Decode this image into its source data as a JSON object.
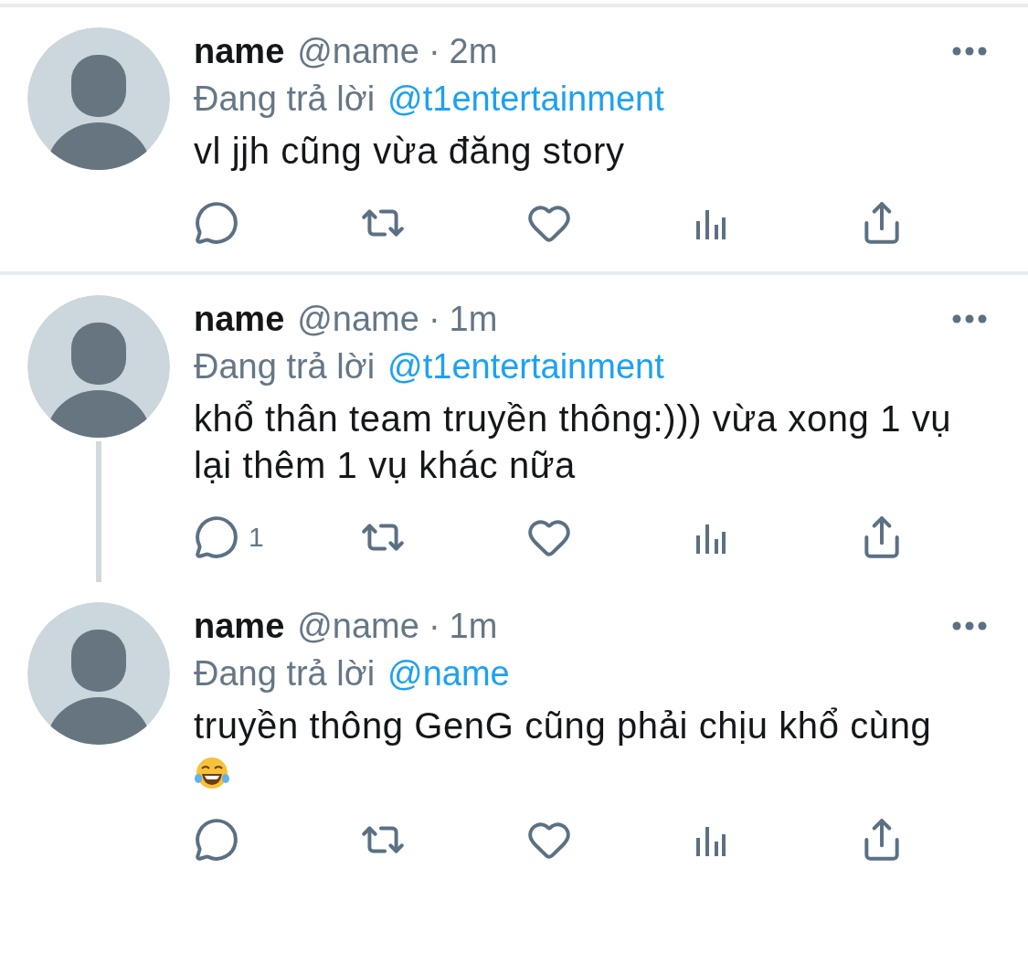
{
  "tweets": [
    {
      "name": "name",
      "handle": "@name",
      "separator": "·",
      "time": "2m",
      "reply_label": "Đang trả lời",
      "reply_to": "@t1entertainment",
      "body": "vl jjh cũng vừa đăng story",
      "trailing_emoji": false,
      "thread_line": false,
      "divider_after": true
    },
    {
      "name": "name",
      "handle": "@name",
      "separator": "·",
      "time": "1m",
      "reply_label": "Đang trả lời",
      "reply_to": "@t1entertainment",
      "body": "khổ thân team truyền thông:))) vừa xong 1 vụ lại thêm 1 vụ khác nữa",
      "trailing_emoji": false,
      "reply_count": "1",
      "thread_line": true,
      "divider_after": false
    },
    {
      "name": "name",
      "handle": "@name",
      "separator": "·",
      "time": "1m",
      "reply_label": "Đang trả lời",
      "reply_to": "@name",
      "body": "truyền thông GenG cũng phải chịu khổ cùng",
      "trailing_emoji": true,
      "thread_line": false,
      "divider_after": false
    }
  ]
}
